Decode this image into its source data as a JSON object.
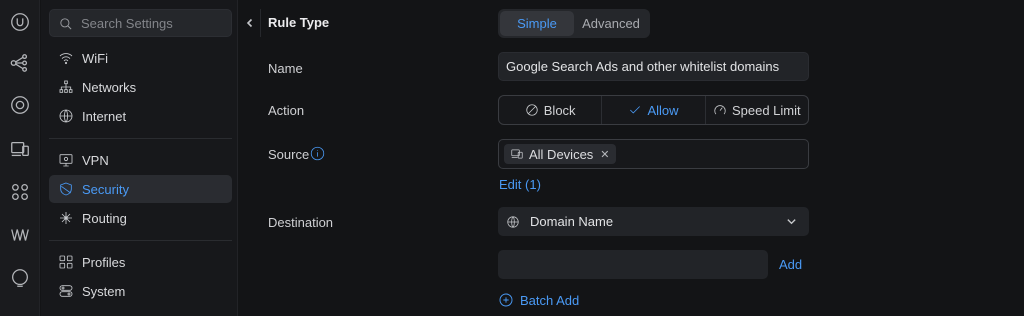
{
  "rail": {
    "icons": [
      "ubiquiti-logo-icon",
      "topology-icon",
      "target-icon",
      "devices-icon",
      "clients-icon",
      "insights-icon",
      "alerts-icon"
    ]
  },
  "sidebar": {
    "search_placeholder": "Search Settings",
    "items": [
      {
        "label": "WiFi",
        "icon": "wifi-icon"
      },
      {
        "label": "Networks",
        "icon": "network-icon"
      },
      {
        "label": "Internet",
        "icon": "globe-icon"
      },
      {
        "label": "VPN",
        "icon": "vpn-icon"
      },
      {
        "label": "Security",
        "icon": "shield-icon",
        "active": true
      },
      {
        "label": "Routing",
        "icon": "routing-icon"
      },
      {
        "label": "Profiles",
        "icon": "profiles-icon"
      },
      {
        "label": "System",
        "icon": "system-icon"
      }
    ]
  },
  "form": {
    "title": "Rule Type",
    "mode_tabs": [
      {
        "label": "Simple",
        "selected": true
      },
      {
        "label": "Advanced",
        "selected": false
      }
    ],
    "name_label": "Name",
    "name_value": "Google Search Ads and other whitelist domains",
    "action_label": "Action",
    "actions": [
      {
        "label": "Block",
        "icon": "block-icon",
        "selected": false
      },
      {
        "label": "Allow",
        "icon": "check-icon",
        "selected": true
      },
      {
        "label": "Speed Limit",
        "icon": "speedometer-icon",
        "selected": false
      }
    ],
    "source_label": "Source",
    "source_chip": "All Devices",
    "source_edit": "Edit (1)",
    "destination_label": "Destination",
    "destination_select": "Domain Name",
    "domain_value": "",
    "add_label": "Add",
    "batch_add_label": "Batch Add"
  },
  "colors": {
    "accent": "#4a9af5",
    "background": "#131416",
    "sidebar": "#17181b"
  }
}
